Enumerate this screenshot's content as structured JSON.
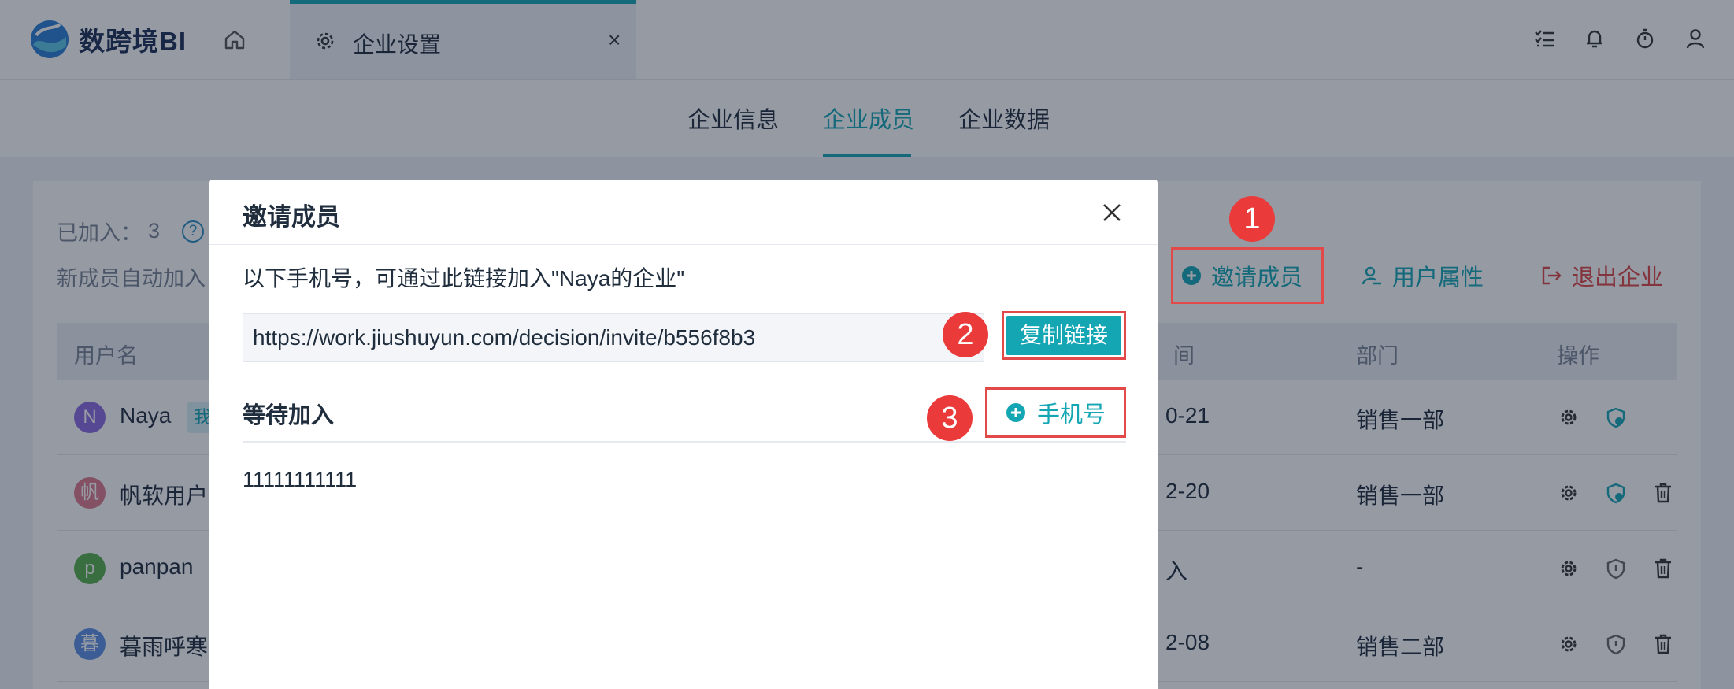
{
  "app": {
    "logo_text": "数跨境BI"
  },
  "tabs": {
    "page_tab_label": "企业设置",
    "close_glyph": "×"
  },
  "subtabs": [
    "企业信息",
    "企业成员",
    "企业数据"
  ],
  "active_subtab": "企业成员",
  "members": {
    "joined_label": "已加入：",
    "joined_count": "3",
    "help_glyph": "?",
    "autojoin_text": "新成员自动加入",
    "actions": {
      "invite": "邀请成员",
      "attributes": "用户属性",
      "exit": "退出企业"
    },
    "columns": {
      "username": "用户名",
      "date": "间",
      "dept": "部门",
      "ops": "操作"
    },
    "rows": [
      {
        "avatar": "N",
        "avatar_color": "#8c6be0",
        "name": "Naya",
        "tag": "我",
        "date": "0-21",
        "dept": "销售一部"
      },
      {
        "avatar": "帆",
        "avatar_color": "#e07b8c",
        "name": "帆软用户",
        "date": "2-20",
        "dept": "销售一部"
      },
      {
        "avatar": "p",
        "avatar_color": "#58b04d",
        "name": "panpan",
        "date": "入",
        "dept": "-"
      },
      {
        "avatar": "暮",
        "avatar_color": "#5e8fe6",
        "name": "暮雨呼寒",
        "date": "2-08",
        "dept": "销售二部"
      }
    ]
  },
  "dialog": {
    "title": "邀请成员",
    "description": "以下手机号，可通过此链接加入\"Naya的企业\"",
    "invite_link": "https://work.jiushuyun.com/decision/invite/b556f8b3",
    "copy_button": "复制链接",
    "waiting_title": "等待加入",
    "add_phone_button": "手机号",
    "pending_phones": [
      "11111111111"
    ]
  },
  "badges": [
    "1",
    "2",
    "3"
  ],
  "colors": {
    "accent": "#15a6b4",
    "danger": "#e04545",
    "highlight": "#e24a4a",
    "badge": "#ea3a3a"
  }
}
